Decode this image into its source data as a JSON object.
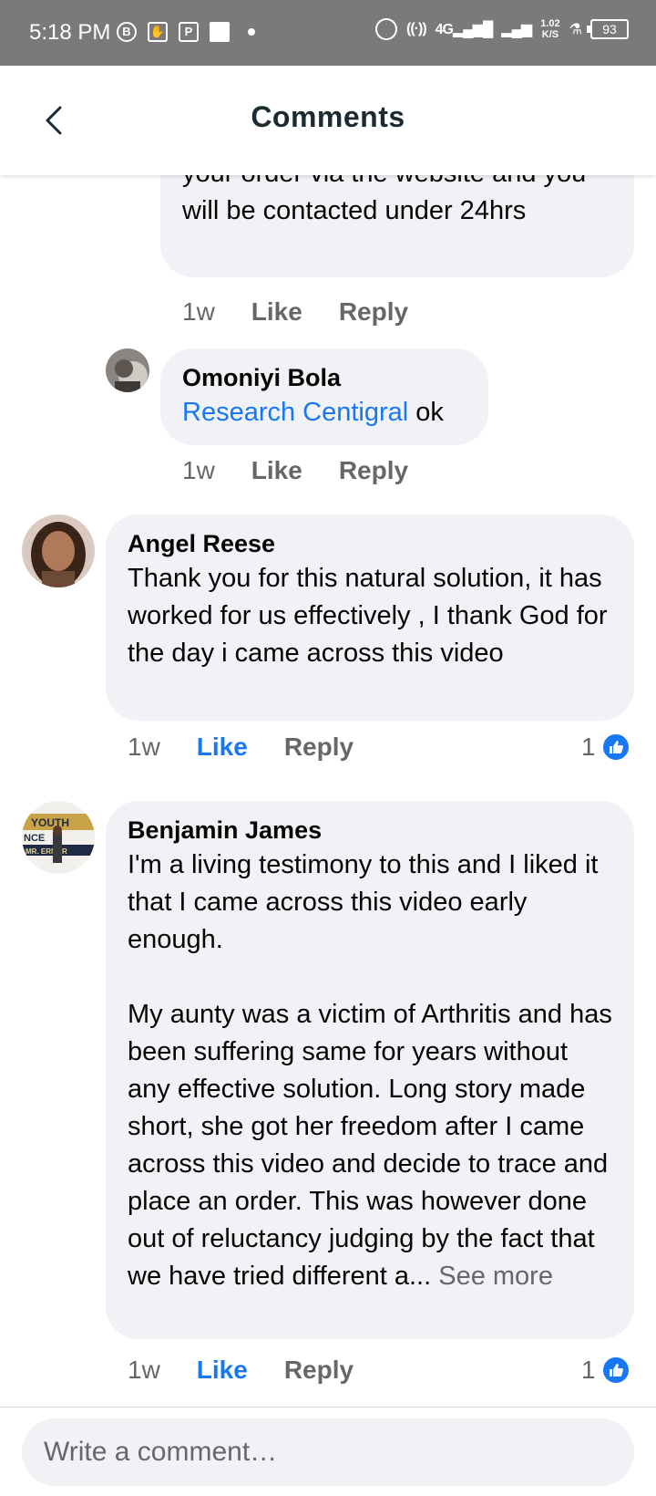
{
  "status_bar": {
    "time": "5:18 PM",
    "network": "4G",
    "speed_value": "1.02",
    "speed_unit": "K/S",
    "battery": "93",
    "icons": [
      "b-icon",
      "hand-icon",
      "p-icon",
      "square-icon",
      "dot-icon",
      "alarm-icon",
      "hotspot-icon",
      "signal-icon",
      "signal-icon",
      "lab-icon",
      "battery-icon"
    ]
  },
  "header": {
    "title": "Comments",
    "back_icon": "chevron-left-icon"
  },
  "comments": [
    {
      "text": "your order via the website and you will be contacted under 24hrs",
      "time": "1w",
      "like_label": "Like",
      "reply_label": "Reply"
    },
    {
      "author": "Omoniyi Bola",
      "mention": "Research Centigral",
      "text": " ok",
      "time": "1w",
      "like_label": "Like",
      "reply_label": "Reply"
    },
    {
      "author": "Angel Reese",
      "text": "Thank you for this natural solution, it has worked for us effectively , I thank God for the day i came across this video",
      "time": "1w",
      "like_label": "Like",
      "reply_label": "Reply",
      "reaction_count": "1",
      "liked": true
    },
    {
      "author": "Benjamin James",
      "text_p1": "I'm a living testimony to this and I liked it that I came across this video early enough.",
      "text_p2": "My aunty was a victim of Arthritis and has been suffering same for years without any effective solution. Long story made short, she got her freedom after I came across this video and decide to trace and place an order. This was however done out of reluctancy judging by the fact that we have tried different a...",
      "see_more": "See more",
      "avatar_text_top": "YOUTH",
      "avatar_text_mid": "NCE",
      "avatar_text_bot": "MR. ERNOR",
      "time": "1w",
      "like_label": "Like",
      "reply_label": "Reply",
      "reaction_count": "1",
      "liked": true
    }
  ],
  "composer": {
    "placeholder": "Write a comment…"
  },
  "colors": {
    "status_bar": "#7a7a7a",
    "bubble": "#f0f2f5",
    "link_blue": "#1877f2",
    "secondary_text": "#65676b"
  }
}
